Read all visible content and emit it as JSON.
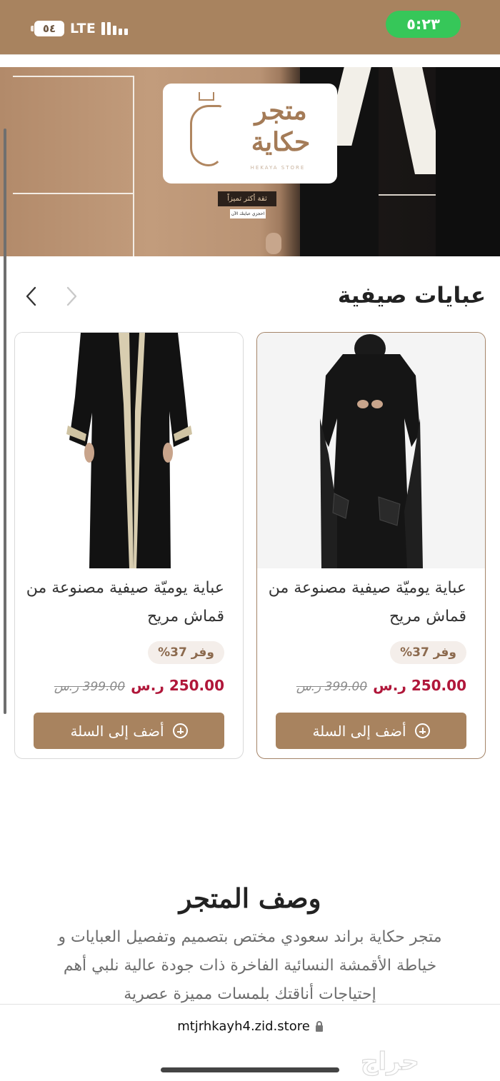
{
  "status_bar": {
    "battery": "٥٤",
    "network": "LTE",
    "time": "٥:٢٣"
  },
  "hero": {
    "logo_text": "متجر حكاية",
    "logo_subtext": "HEKAYA STORE",
    "tagline": "ثقة أكثر تميزاً",
    "cta": "احجزي عبايتك الآن"
  },
  "section": {
    "title": "عبايات صيفية",
    "prev_icon": "chevron-left-icon",
    "next_icon": "chevron-right-icon"
  },
  "products": [
    {
      "title": "عباية يوميّة صيفية مصنوعة من قماش مريح",
      "discount": "وفر 37%",
      "price": "250.00 ر.س",
      "old_price": "399.00 ر.س",
      "button": "أضف إلى السلة"
    },
    {
      "title": "عباية يوميّة صيفية مصنوعة من قماش مريح",
      "discount": "وفر 37%",
      "price": "250.00 ر.س",
      "old_price": "399.00 ر.س",
      "button": "أضف إلى السلة"
    }
  ],
  "store_description": {
    "heading": "وصف المتجر",
    "text": "متجر حكاية براند سعودي مختص بتصميم وتفصيل العبايات و خياطة الأقمشة النسائية الفاخرة ذات جودة عالية نلبي أهم إحتياجات أناقتك بلمسات مميزة عصرية"
  },
  "browser": {
    "url": "mtjrhkayh4.zid.store",
    "watermark": "حراج"
  },
  "colors": {
    "brand": "#a8835f",
    "price": "#b0173a",
    "time_pill": "#36c759"
  }
}
